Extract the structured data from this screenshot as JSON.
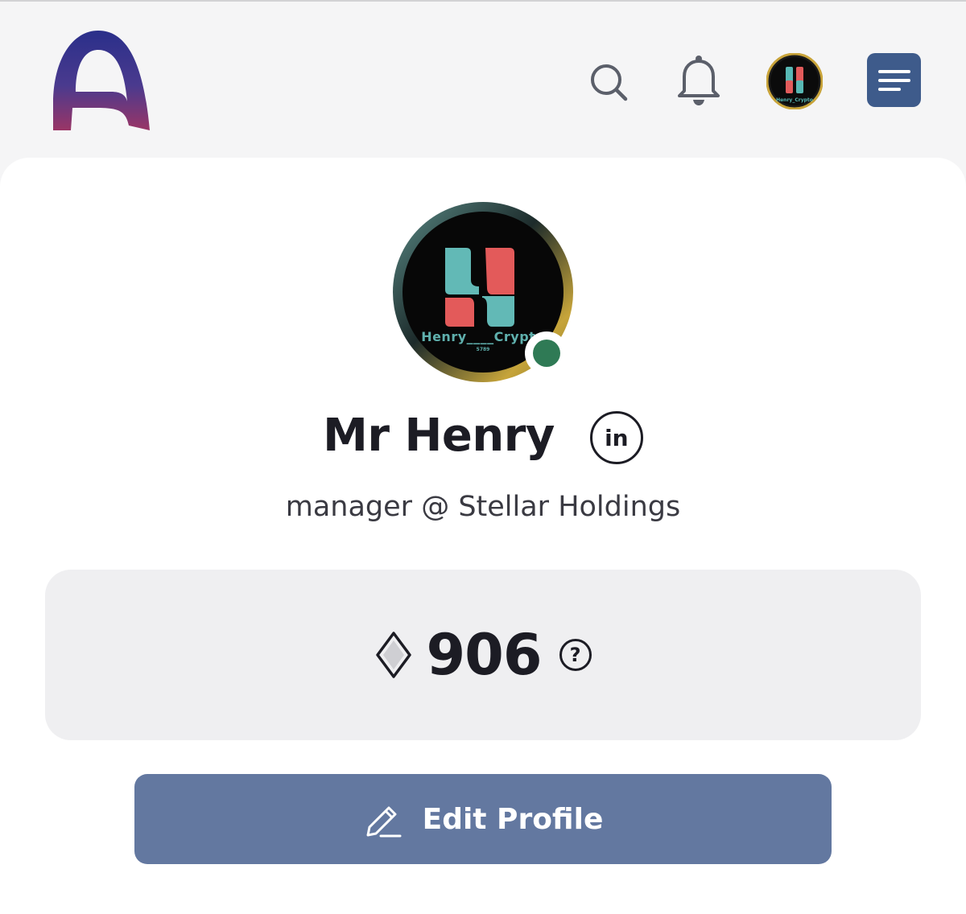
{
  "header": {
    "logo_icon": "app-logo-arch",
    "search_icon": "search-icon",
    "notifications_icon": "bell-icon",
    "avatar_text": "Henry_Crypto",
    "menu_icon": "menu-icon",
    "menu_bg": "#3e5b8b"
  },
  "profile": {
    "avatar_text": "Henry",
    "avatar_text_suffix": "Crypto",
    "avatar_subtext": "5789",
    "online_status_color": "#2f7a55",
    "name": "Mr Henry",
    "linkedin_label": "in",
    "role": "manager @ Stellar Holdings"
  },
  "points": {
    "icon": "diamond-icon",
    "value": "906",
    "help_label": "?"
  },
  "actions": {
    "edit_profile_label": "Edit Profile",
    "edit_icon": "pencil-icon",
    "button_color": "#6378a0"
  }
}
